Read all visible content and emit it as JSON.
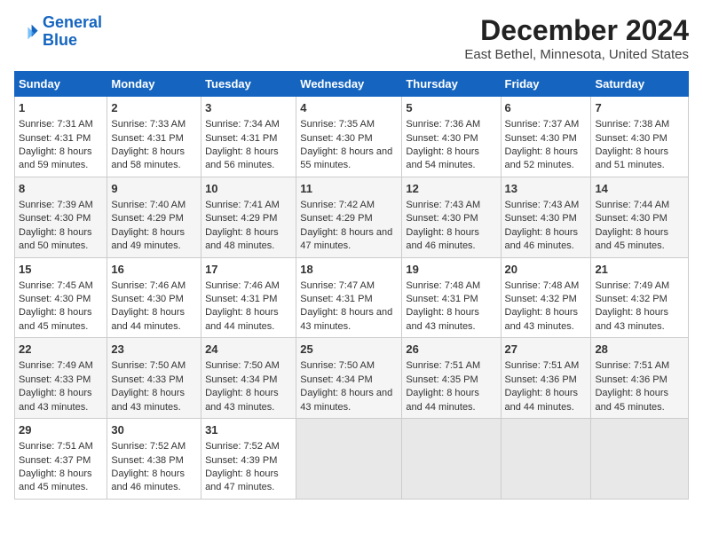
{
  "header": {
    "logo_line1": "General",
    "logo_line2": "Blue",
    "title": "December 2024",
    "subtitle": "East Bethel, Minnesota, United States"
  },
  "columns": [
    "Sunday",
    "Monday",
    "Tuesday",
    "Wednesday",
    "Thursday",
    "Friday",
    "Saturday"
  ],
  "weeks": [
    [
      {
        "day": "1",
        "sunrise": "Sunrise: 7:31 AM",
        "sunset": "Sunset: 4:31 PM",
        "daylight": "Daylight: 8 hours and 59 minutes."
      },
      {
        "day": "2",
        "sunrise": "Sunrise: 7:33 AM",
        "sunset": "Sunset: 4:31 PM",
        "daylight": "Daylight: 8 hours and 58 minutes."
      },
      {
        "day": "3",
        "sunrise": "Sunrise: 7:34 AM",
        "sunset": "Sunset: 4:31 PM",
        "daylight": "Daylight: 8 hours and 56 minutes."
      },
      {
        "day": "4",
        "sunrise": "Sunrise: 7:35 AM",
        "sunset": "Sunset: 4:30 PM",
        "daylight": "Daylight: 8 hours and 55 minutes."
      },
      {
        "day": "5",
        "sunrise": "Sunrise: 7:36 AM",
        "sunset": "Sunset: 4:30 PM",
        "daylight": "Daylight: 8 hours and 54 minutes."
      },
      {
        "day": "6",
        "sunrise": "Sunrise: 7:37 AM",
        "sunset": "Sunset: 4:30 PM",
        "daylight": "Daylight: 8 hours and 52 minutes."
      },
      {
        "day": "7",
        "sunrise": "Sunrise: 7:38 AM",
        "sunset": "Sunset: 4:30 PM",
        "daylight": "Daylight: 8 hours and 51 minutes."
      }
    ],
    [
      {
        "day": "8",
        "sunrise": "Sunrise: 7:39 AM",
        "sunset": "Sunset: 4:30 PM",
        "daylight": "Daylight: 8 hours and 50 minutes."
      },
      {
        "day": "9",
        "sunrise": "Sunrise: 7:40 AM",
        "sunset": "Sunset: 4:29 PM",
        "daylight": "Daylight: 8 hours and 49 minutes."
      },
      {
        "day": "10",
        "sunrise": "Sunrise: 7:41 AM",
        "sunset": "Sunset: 4:29 PM",
        "daylight": "Daylight: 8 hours and 48 minutes."
      },
      {
        "day": "11",
        "sunrise": "Sunrise: 7:42 AM",
        "sunset": "Sunset: 4:29 PM",
        "daylight": "Daylight: 8 hours and 47 minutes."
      },
      {
        "day": "12",
        "sunrise": "Sunrise: 7:43 AM",
        "sunset": "Sunset: 4:30 PM",
        "daylight": "Daylight: 8 hours and 46 minutes."
      },
      {
        "day": "13",
        "sunrise": "Sunrise: 7:43 AM",
        "sunset": "Sunset: 4:30 PM",
        "daylight": "Daylight: 8 hours and 46 minutes."
      },
      {
        "day": "14",
        "sunrise": "Sunrise: 7:44 AM",
        "sunset": "Sunset: 4:30 PM",
        "daylight": "Daylight: 8 hours and 45 minutes."
      }
    ],
    [
      {
        "day": "15",
        "sunrise": "Sunrise: 7:45 AM",
        "sunset": "Sunset: 4:30 PM",
        "daylight": "Daylight: 8 hours and 45 minutes."
      },
      {
        "day": "16",
        "sunrise": "Sunrise: 7:46 AM",
        "sunset": "Sunset: 4:30 PM",
        "daylight": "Daylight: 8 hours and 44 minutes."
      },
      {
        "day": "17",
        "sunrise": "Sunrise: 7:46 AM",
        "sunset": "Sunset: 4:31 PM",
        "daylight": "Daylight: 8 hours and 44 minutes."
      },
      {
        "day": "18",
        "sunrise": "Sunrise: 7:47 AM",
        "sunset": "Sunset: 4:31 PM",
        "daylight": "Daylight: 8 hours and 43 minutes."
      },
      {
        "day": "19",
        "sunrise": "Sunrise: 7:48 AM",
        "sunset": "Sunset: 4:31 PM",
        "daylight": "Daylight: 8 hours and 43 minutes."
      },
      {
        "day": "20",
        "sunrise": "Sunrise: 7:48 AM",
        "sunset": "Sunset: 4:32 PM",
        "daylight": "Daylight: 8 hours and 43 minutes."
      },
      {
        "day": "21",
        "sunrise": "Sunrise: 7:49 AM",
        "sunset": "Sunset: 4:32 PM",
        "daylight": "Daylight: 8 hours and 43 minutes."
      }
    ],
    [
      {
        "day": "22",
        "sunrise": "Sunrise: 7:49 AM",
        "sunset": "Sunset: 4:33 PM",
        "daylight": "Daylight: 8 hours and 43 minutes."
      },
      {
        "day": "23",
        "sunrise": "Sunrise: 7:50 AM",
        "sunset": "Sunset: 4:33 PM",
        "daylight": "Daylight: 8 hours and 43 minutes."
      },
      {
        "day": "24",
        "sunrise": "Sunrise: 7:50 AM",
        "sunset": "Sunset: 4:34 PM",
        "daylight": "Daylight: 8 hours and 43 minutes."
      },
      {
        "day": "25",
        "sunrise": "Sunrise: 7:50 AM",
        "sunset": "Sunset: 4:34 PM",
        "daylight": "Daylight: 8 hours and 43 minutes."
      },
      {
        "day": "26",
        "sunrise": "Sunrise: 7:51 AM",
        "sunset": "Sunset: 4:35 PM",
        "daylight": "Daylight: 8 hours and 44 minutes."
      },
      {
        "day": "27",
        "sunrise": "Sunrise: 7:51 AM",
        "sunset": "Sunset: 4:36 PM",
        "daylight": "Daylight: 8 hours and 44 minutes."
      },
      {
        "day": "28",
        "sunrise": "Sunrise: 7:51 AM",
        "sunset": "Sunset: 4:36 PM",
        "daylight": "Daylight: 8 hours and 45 minutes."
      }
    ],
    [
      {
        "day": "29",
        "sunrise": "Sunrise: 7:51 AM",
        "sunset": "Sunset: 4:37 PM",
        "daylight": "Daylight: 8 hours and 45 minutes."
      },
      {
        "day": "30",
        "sunrise": "Sunrise: 7:52 AM",
        "sunset": "Sunset: 4:38 PM",
        "daylight": "Daylight: 8 hours and 46 minutes."
      },
      {
        "day": "31",
        "sunrise": "Sunrise: 7:52 AM",
        "sunset": "Sunset: 4:39 PM",
        "daylight": "Daylight: 8 hours and 47 minutes."
      },
      null,
      null,
      null,
      null
    ]
  ]
}
